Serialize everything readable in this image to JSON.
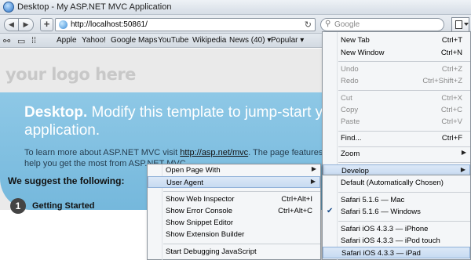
{
  "window": {
    "title": "Desktop - My ASP.NET MVC Application"
  },
  "toolbar": {
    "back_icon": "back-arrow-icon",
    "forward_icon": "forward-arrow-icon",
    "new_tab_label": "+",
    "url": "http://localhost:50861/",
    "reload_icon": "reload-icon",
    "search_placeholder": "Google"
  },
  "bookmarks": {
    "items": [
      "Apple",
      "Yahoo!",
      "Google Maps",
      "YouTube",
      "Wikipedia",
      "News (40) ▾",
      "Popular ▾"
    ]
  },
  "page": {
    "logo": "your logo here",
    "hero_strong": "Desktop.",
    "hero_rest": " Modify this template to jump-start your ASP.NET MVC application.",
    "para_prefix": "To learn more about ASP.NET MVC visit ",
    "para_link": "http://asp.net/mvc",
    "para_suffix": ". The page features videos, tutorials, and samples to help you get the most from ASP.NET MVC.",
    "suggest_heading": "We suggest the following:",
    "step_number": "1",
    "step_title": "Getting Started"
  },
  "page_menu": {
    "items": [
      {
        "label": "New Tab",
        "shortcut": "Ctrl+T",
        "enabled": true
      },
      {
        "label": "New Window",
        "shortcut": "Ctrl+N",
        "enabled": true
      },
      {
        "label": "Undo",
        "shortcut": "Ctrl+Z",
        "enabled": false
      },
      {
        "label": "Redo",
        "shortcut": "Ctrl+Shift+Z",
        "enabled": false
      },
      {
        "label": "Cut",
        "shortcut": "Ctrl+X",
        "enabled": false
      },
      {
        "label": "Copy",
        "shortcut": "Ctrl+C",
        "enabled": false
      },
      {
        "label": "Paste",
        "shortcut": "Ctrl+V",
        "enabled": false
      },
      {
        "label": "Find...",
        "shortcut": "Ctrl+F",
        "enabled": true
      },
      {
        "label": "Zoom",
        "shortcut": "",
        "enabled": true
      },
      {
        "label": "Develop",
        "shortcut": "",
        "enabled": true
      }
    ]
  },
  "develop_menu": {
    "items": [
      {
        "label": "Open Page With",
        "shortcut": ""
      },
      {
        "label": "User Agent",
        "shortcut": ""
      },
      {
        "label": "Show Web Inspector",
        "shortcut": "Ctrl+Alt+I"
      },
      {
        "label": "Show Error Console",
        "shortcut": "Ctrl+Alt+C"
      },
      {
        "label": "Show Snippet Editor",
        "shortcut": ""
      },
      {
        "label": "Show Extension Builder",
        "shortcut": ""
      },
      {
        "label": "Start Debugging JavaScript",
        "shortcut": ""
      }
    ]
  },
  "user_agent_menu": {
    "items": [
      {
        "label": "Default (Automatically Chosen)",
        "checked": false
      },
      {
        "label": "Safari 5.1.6 — Mac",
        "checked": false
      },
      {
        "label": "Safari 5.1.6 — Windows",
        "checked": true
      },
      {
        "label": "Safari iOS 4.3.3 — iPhone",
        "checked": false
      },
      {
        "label": "Safari iOS 4.3.3 — iPod touch",
        "checked": false
      },
      {
        "label": "Safari iOS 4.3.3 — iPad",
        "checked": false
      }
    ],
    "highlighted": "Safari iOS 4.3.3 — iPad"
  }
}
